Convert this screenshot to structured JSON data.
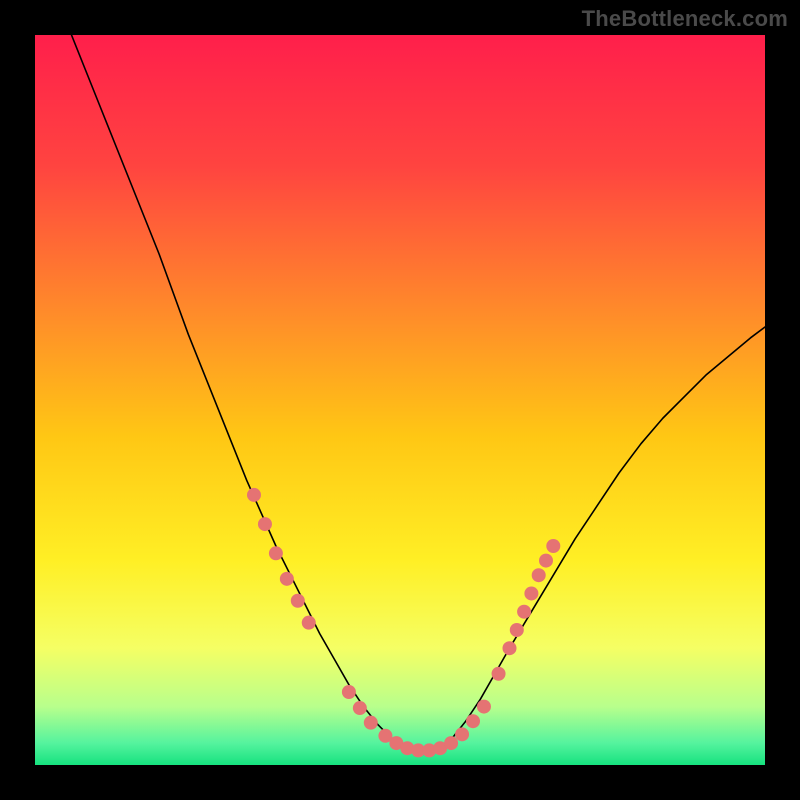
{
  "watermark": "TheBottleneck.com",
  "chart_data": {
    "type": "line",
    "title": "",
    "xlabel": "",
    "ylabel": "",
    "xlim": [
      0,
      100
    ],
    "ylim": [
      0,
      100
    ],
    "grid": false,
    "background_gradient": {
      "stops": [
        {
          "offset": 0.0,
          "color": "#ff1f4b"
        },
        {
          "offset": 0.18,
          "color": "#ff4440"
        },
        {
          "offset": 0.38,
          "color": "#ff8b2a"
        },
        {
          "offset": 0.55,
          "color": "#ffc714"
        },
        {
          "offset": 0.72,
          "color": "#ffef25"
        },
        {
          "offset": 0.84,
          "color": "#f5ff64"
        },
        {
          "offset": 0.92,
          "color": "#b8ff8c"
        },
        {
          "offset": 0.97,
          "color": "#55f39e"
        },
        {
          "offset": 1.0,
          "color": "#16e27f"
        }
      ]
    },
    "series": [
      {
        "name": "curve",
        "color": "#000000",
        "width": 1.6,
        "x": [
          5,
          7,
          9,
          11,
          13,
          15,
          17,
          19,
          21,
          23,
          25,
          27,
          29,
          31,
          33,
          35,
          37,
          39,
          41,
          43,
          45,
          47,
          49,
          51,
          53,
          55,
          57,
          59,
          61,
          63,
          65,
          68,
          71,
          74,
          77,
          80,
          83,
          86,
          89,
          92,
          95,
          98,
          100
        ],
        "y": [
          100,
          95,
          90,
          85,
          80,
          75,
          70,
          64.5,
          59,
          54,
          49,
          44,
          39,
          34.5,
          30,
          26,
          22,
          18,
          14.5,
          11,
          8,
          5.5,
          3.5,
          2,
          1.5,
          2,
          3.5,
          6,
          9,
          12.5,
          16,
          21,
          26,
          31,
          35.5,
          40,
          44,
          47.5,
          50.5,
          53.5,
          56,
          58.5,
          60
        ]
      }
    ],
    "scatter": [
      {
        "name": "dots",
        "color": "#e57373",
        "radius_px": 7,
        "points": [
          {
            "x": 30,
            "y": 37
          },
          {
            "x": 31.5,
            "y": 33
          },
          {
            "x": 33,
            "y": 29
          },
          {
            "x": 34.5,
            "y": 25.5
          },
          {
            "x": 36,
            "y": 22.5
          },
          {
            "x": 37.5,
            "y": 19.5
          },
          {
            "x": 43,
            "y": 10
          },
          {
            "x": 44.5,
            "y": 7.8
          },
          {
            "x": 46,
            "y": 5.8
          },
          {
            "x": 48,
            "y": 4
          },
          {
            "x": 49.5,
            "y": 3
          },
          {
            "x": 51,
            "y": 2.3
          },
          {
            "x": 52.5,
            "y": 2
          },
          {
            "x": 54,
            "y": 2
          },
          {
            "x": 55.5,
            "y": 2.3
          },
          {
            "x": 57,
            "y": 3
          },
          {
            "x": 58.5,
            "y": 4.2
          },
          {
            "x": 60,
            "y": 6
          },
          {
            "x": 61.5,
            "y": 8
          },
          {
            "x": 63.5,
            "y": 12.5
          },
          {
            "x": 65,
            "y": 16
          },
          {
            "x": 66,
            "y": 18.5
          },
          {
            "x": 67,
            "y": 21
          },
          {
            "x": 68,
            "y": 23.5
          },
          {
            "x": 69,
            "y": 26
          },
          {
            "x": 70,
            "y": 28
          },
          {
            "x": 71,
            "y": 30
          }
        ]
      }
    ]
  }
}
